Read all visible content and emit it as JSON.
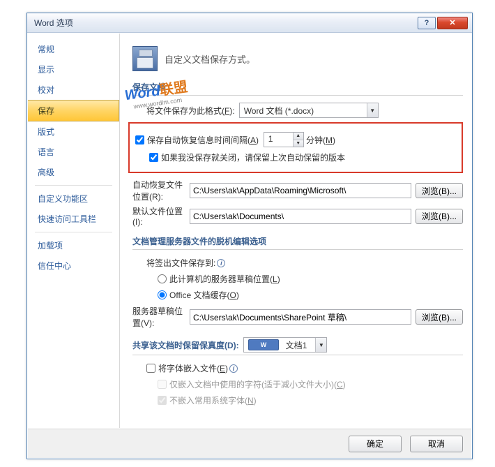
{
  "window": {
    "title": "Word 选项"
  },
  "winbuttons": {
    "help": "?",
    "close": "✕"
  },
  "sidebar": {
    "items": [
      {
        "label": "常规"
      },
      {
        "label": "显示"
      },
      {
        "label": "校对"
      },
      {
        "label": "保存",
        "selected": true
      },
      {
        "label": "版式"
      },
      {
        "label": "语言"
      },
      {
        "label": "高级"
      },
      {
        "sep": true
      },
      {
        "label": "自定义功能区"
      },
      {
        "label": "快速访问工具栏"
      },
      {
        "sep": true
      },
      {
        "label": "加载项"
      },
      {
        "label": "信任中心"
      }
    ]
  },
  "header": "自定义文档保存方式。",
  "sections": {
    "save_docs": "保存文档",
    "offline": "文档管理服务器文件的脱机编辑选项",
    "fidelity": "共享该文档时保留保真度(D):"
  },
  "save": {
    "format_label_pre": "将文件保存为此格式(",
    "format_key": "F",
    "format_label_post": "):",
    "format_value": "Word 文档 (*.docx)",
    "autorecover_pre": "保存自动恢复信息时间间隔(",
    "autorecover_key": "A",
    "autorecover_post": ")",
    "autorecover_value": "1",
    "minutes_pre": "分钟(",
    "minutes_key": "M",
    "minutes_post": ")",
    "keep_last": "如果我没保存就关闭，请保留上次自动保留的版本",
    "autorecover_loc_label_pre": "自动恢复文件位置(",
    "autorecover_loc_key": "R",
    "autorecover_loc_label_post": "):",
    "autorecover_loc_value": "C:\\Users\\ak\\AppData\\Roaming\\Microsoft\\",
    "default_loc_label_pre": "默认文件位置(",
    "default_loc_key": "I",
    "default_loc_label_post": "):",
    "default_loc_value": "C:\\Users\\ak\\Documents\\",
    "browse_pre": "浏览(",
    "browse_key": "B",
    "browse_post": ")..."
  },
  "offline": {
    "checkout_label": "将签出文件保存到:",
    "radio1_pre": "此计算机的服务器草稿位置(",
    "radio1_key": "L",
    "radio1_post": ")",
    "radio2_pre": "Office 文档缓存(",
    "radio2_key": "O",
    "radio2_post": ")",
    "draft_loc_label_pre": "服务器草稿位置(",
    "draft_loc_key": "V",
    "draft_loc_label_post": "):",
    "draft_loc_value": "C:\\Users\\ak\\Documents\\SharePoint 草稿\\"
  },
  "fidelity": {
    "doc_name": "文档1",
    "embed_pre": "将字体嵌入文件(",
    "embed_key": "E",
    "embed_post": ")",
    "embed_used_pre": "仅嵌入文档中使用的字符(适于减小文件大小)(",
    "embed_used_key": "C",
    "embed_used_post": ")",
    "no_common_pre": "不嵌入常用系统字体(",
    "no_common_key": "N",
    "no_common_post": ")"
  },
  "footer": {
    "ok": "确定",
    "cancel": "取消"
  },
  "watermark": {
    "brand_en": "Word",
    "brand_cn": "联盟",
    "url": "www.wordlm.com"
  }
}
